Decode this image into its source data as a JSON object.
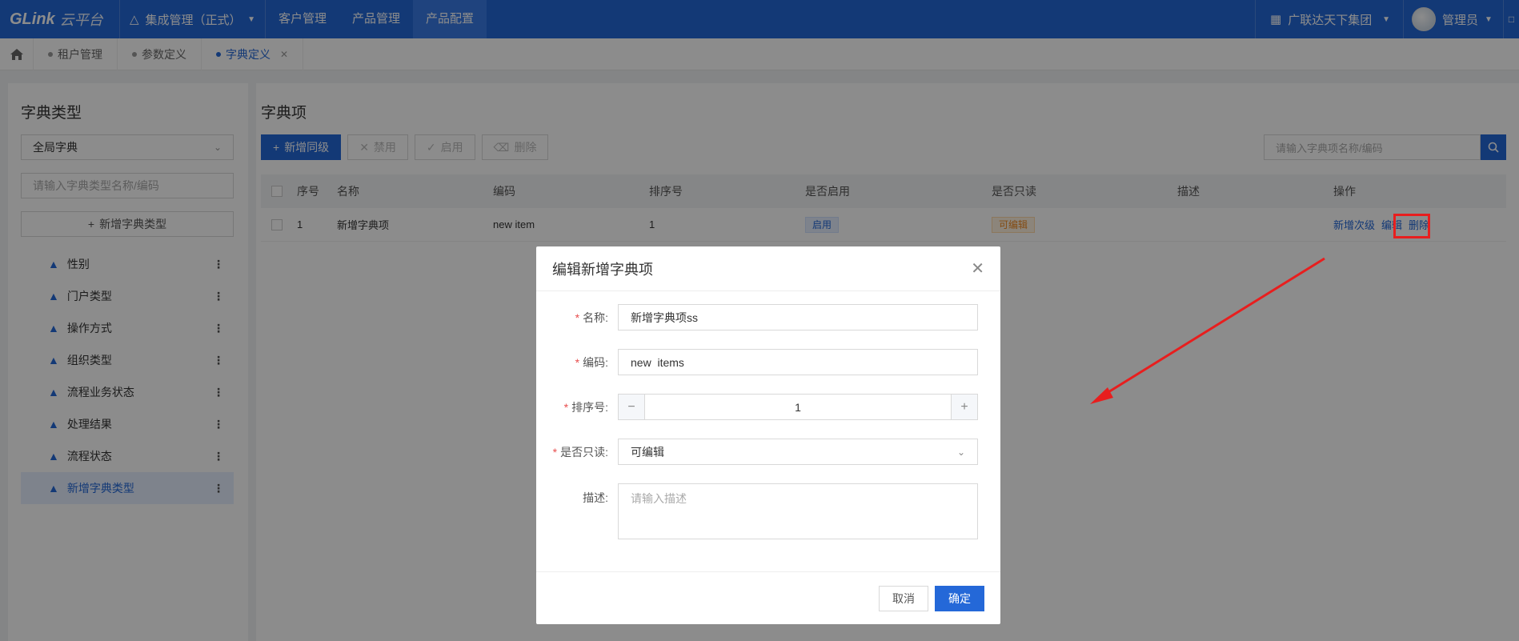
{
  "topbar": {
    "logo": "GLink",
    "logo_sub": "云平台",
    "app_selector": "集成管理（正式）",
    "nav": [
      "客户管理",
      "产品管理",
      "产品配置"
    ],
    "org": "广联达天下集团",
    "user": "管理员"
  },
  "tabs": [
    "租户管理",
    "参数定义",
    "字典定义"
  ],
  "left": {
    "title": "字典类型",
    "select_value": "全局字典",
    "search_placeholder": "请输入字典类型名称/编码",
    "add_label": "新增字典类型",
    "tree": [
      "性别",
      "门户类型",
      "操作方式",
      "组织类型",
      "流程业务状态",
      "处理结果",
      "流程状态",
      "新增字典类型"
    ]
  },
  "main": {
    "title": "字典项",
    "toolbar": {
      "add": "新增同级",
      "disable": "禁用",
      "enable": "启用",
      "delete": "删除"
    },
    "search_placeholder": "请输入字典项名称/编码",
    "columns": [
      "序号",
      "名称",
      "编码",
      "排序号",
      "是否启用",
      "是否只读",
      "描述",
      "操作"
    ],
    "rows": [
      {
        "seq": "1",
        "name": "新增字典项",
        "code": "new item",
        "sort": "1",
        "enabled": "启用",
        "readonly": "可编辑",
        "desc": "",
        "ops": [
          "新增次级",
          "编辑",
          "删除"
        ]
      }
    ]
  },
  "modal": {
    "title": "编辑新增字典项",
    "name_label": "名称:",
    "name_value": "新增字典项ss",
    "code_label": "编码:",
    "code_value": "new  items",
    "sort_label": "排序号:",
    "sort_value": "1",
    "readonly_label": "是否只读:",
    "readonly_value": "可编辑",
    "desc_label": "描述:",
    "desc_placeholder": "请输入描述",
    "cancel": "取消",
    "ok": "确定"
  },
  "colors": {
    "primary": "#2468d8",
    "annotation": "#e81e1e"
  }
}
